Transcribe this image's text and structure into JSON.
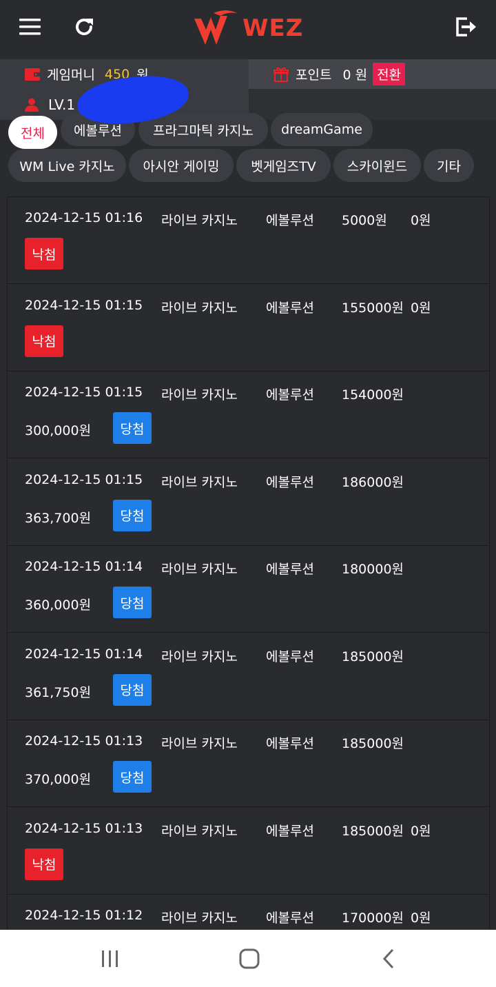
{
  "header": {
    "logo_text": "WEZ",
    "icons": {
      "menu": "hamburger-icon",
      "refresh": "refresh-icon",
      "logout": "logout-icon"
    }
  },
  "info": {
    "money_label": "게임머니",
    "money_value": "450",
    "money_unit": "원",
    "point_label": "포인트",
    "point_value": "0 원",
    "exchange_label": "전환",
    "level_label": "LV.1"
  },
  "categories": [
    {
      "label": "전체",
      "active": true
    },
    {
      "label": "에볼루션",
      "active": false
    },
    {
      "label": "프라그마틱 카지노",
      "active": false
    },
    {
      "label": "dreamGame",
      "active": false
    },
    {
      "label": "WM Live 카지노",
      "active": false
    },
    {
      "label": "아시안 게이밍",
      "active": false
    },
    {
      "label": "벳게임즈TV",
      "active": false
    },
    {
      "label": "스카이윈드",
      "active": false
    },
    {
      "label": "기타",
      "active": false
    }
  ],
  "records": [
    {
      "datetime": "2024-12-15 01:16",
      "game": "라이브 카지노",
      "provider": "에볼루션",
      "bet": "5000원",
      "win": "0원",
      "status": "낙첨",
      "result": "lose"
    },
    {
      "datetime": "2024-12-15 01:15",
      "game": "라이브 카지노",
      "provider": "에볼루션",
      "bet": "155000원",
      "win": "0원",
      "status": "낙첨",
      "result": "lose"
    },
    {
      "datetime": "2024-12-15 01:15",
      "game": "라이브 카지노",
      "provider": "에볼루션",
      "bet": "154000원",
      "win": "300,000원",
      "status": "당첨",
      "result": "win"
    },
    {
      "datetime": "2024-12-15 01:15",
      "game": "라이브 카지노",
      "provider": "에볼루션",
      "bet": "186000원",
      "win": "363,700원",
      "status": "당첨",
      "result": "win"
    },
    {
      "datetime": "2024-12-15 01:14",
      "game": "라이브 카지노",
      "provider": "에볼루션",
      "bet": "180000원",
      "win": "360,000원",
      "status": "당첨",
      "result": "win"
    },
    {
      "datetime": "2024-12-15 01:14",
      "game": "라이브 카지노",
      "provider": "에볼루션",
      "bet": "185000원",
      "win": "361,750원",
      "status": "당첨",
      "result": "win"
    },
    {
      "datetime": "2024-12-15 01:13",
      "game": "라이브 카지노",
      "provider": "에볼루션",
      "bet": "185000원",
      "win": "370,000원",
      "status": "당첨",
      "result": "win"
    },
    {
      "datetime": "2024-12-15 01:13",
      "game": "라이브 카지노",
      "provider": "에볼루션",
      "bet": "185000원",
      "win": "0원",
      "status": "낙첨",
      "result": "lose"
    },
    {
      "datetime": "2024-12-15 01:12",
      "game": "라이브 카지노",
      "provider": "에볼루션",
      "bet": "170000원",
      "win": "0원",
      "status": "",
      "result": "lose"
    }
  ],
  "colors": {
    "accent": "#e8204d",
    "win": "#1e7fe8",
    "lose": "#e8222b",
    "money": "#f2c230",
    "logo": "#ef3d30"
  },
  "bottom_nav": {
    "icons": [
      "recent-apps-icon",
      "home-icon",
      "back-icon"
    ]
  }
}
